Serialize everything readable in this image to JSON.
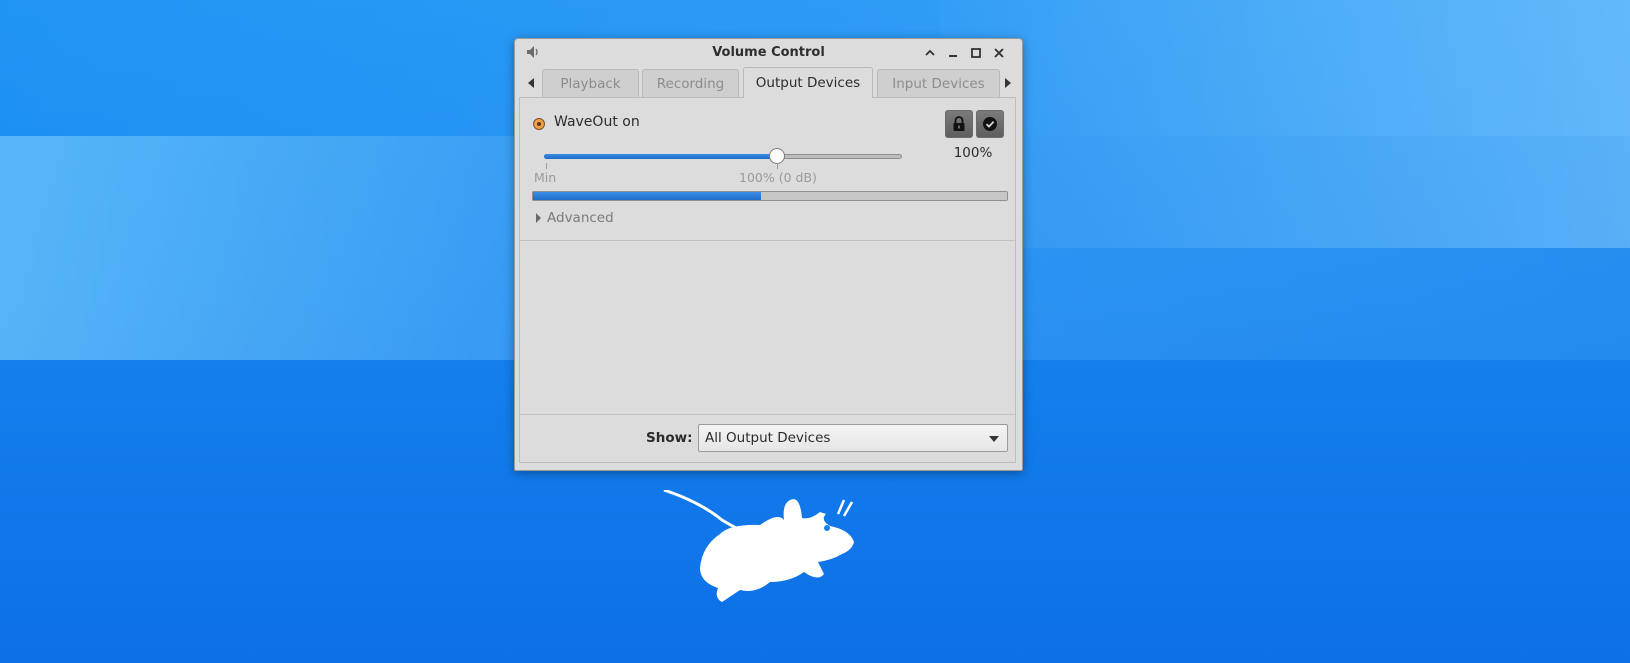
{
  "window": {
    "title": "Volume Control",
    "controls": [
      "chevron-up-icon",
      "minimize-icon",
      "maximize-icon",
      "close-icon"
    ]
  },
  "tabs": [
    {
      "label": "Playback",
      "active": false
    },
    {
      "label": "Recording",
      "active": false
    },
    {
      "label": "Output Devices",
      "active": true
    },
    {
      "label": "Input Devices",
      "active": false
    }
  ],
  "device": {
    "name": "WaveOut on",
    "volume_percent_label": "100%",
    "slider_fraction": 0.65,
    "marks": {
      "min": "Min",
      "normal": "100% (0 dB)"
    },
    "meter_fraction": 0.48,
    "advanced_label": "Advanced",
    "lock_icon": "lock-icon",
    "default_icon": "check-icon"
  },
  "footer": {
    "show_label": "Show:",
    "show_value": "All Output Devices"
  },
  "colors": {
    "accent": "#2f80dd",
    "desktop": "#1583ee"
  }
}
